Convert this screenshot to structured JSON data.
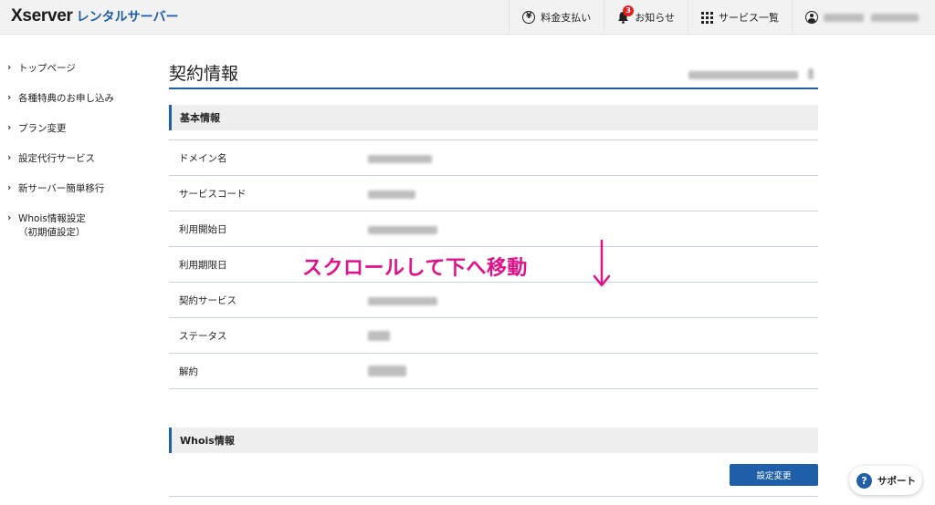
{
  "header": {
    "logo_main": "Xserver",
    "logo_sub": "レンタルサーバー",
    "nav": {
      "billing": "料金支払い",
      "notifications": "お知らせ",
      "notifications_count": "3",
      "services": "サービス一覧",
      "yen_symbol": "¥"
    }
  },
  "sidebar": {
    "items": [
      {
        "label": "トップページ"
      },
      {
        "label": "各種特典のお申し込み"
      },
      {
        "label": "プラン変更"
      },
      {
        "label": "設定代行サービス"
      },
      {
        "label": "新サーバー簡単移行"
      },
      {
        "label": "Whois情報設定",
        "label2": "（初期値設定）"
      }
    ],
    "chevron": "›"
  },
  "main": {
    "title": "契約情報",
    "basic_section": "基本情報",
    "rows": [
      {
        "label": "ドメイン名"
      },
      {
        "label": "サービスコード"
      },
      {
        "label": "利用開始日"
      },
      {
        "label": "利用期限日"
      },
      {
        "label": "契約サービス"
      },
      {
        "label": "ステータス"
      },
      {
        "label": "解約"
      }
    ],
    "whois_section": "Whois情報",
    "settings_button": "設定変更"
  },
  "overlay": {
    "text": "スクロールして下へ移動",
    "color": "#e4108a"
  },
  "support": {
    "label": "サポート",
    "icon": "?"
  },
  "colors": {
    "accent": "#1f5ea8",
    "header_bg": "#f2f2f2",
    "badge": "#e02020"
  }
}
